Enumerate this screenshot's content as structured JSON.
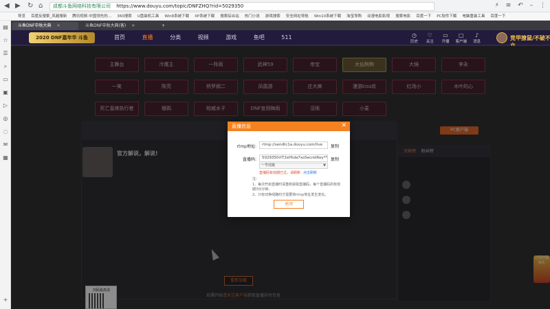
{
  "browser": {
    "address_cert": "成都斗鱼网络科技有限公司",
    "address_url": "https://www.douyu.com/topic/DNFZHQ?rid=5029350",
    "bookmarks": [
      "导览",
      "百度反搜索_风越搜新",
      "腾讯视频-中国领先的…",
      "360搜索",
      "U盘装机工具",
      "Win8系统下载",
      "XP系统下载",
      "搜索综合站",
      "热门小说",
      "游戏搜索",
      "安全网址导航",
      "Win10系统下载",
      "淘宝导购",
      "动漫电影影视",
      "搜索电影",
      "百度一下",
      "PC软件下载",
      "电脑重装工具",
      "百度一下"
    ]
  },
  "tabs": [
    {
      "label": "斗鱼DNF中秋大典",
      "active": true
    },
    {
      "label": "斗鱼DNF中秋大典(客)",
      "active": false
    }
  ],
  "site": {
    "logo_text": "2020 DNF嘉年华 斗鱼",
    "nav": [
      "首页",
      "直播",
      "分类",
      "视频",
      "游戏",
      "鱼吧",
      "511"
    ],
    "nav_active_index": 1,
    "header_icons": [
      {
        "icon": "clock-icon",
        "label": "历史"
      },
      {
        "icon": "star-icon",
        "label": "关注"
      },
      {
        "icon": "video-icon",
        "label": "开播"
      },
      {
        "icon": "app-icon",
        "label": "客户端"
      },
      {
        "icon": "bell-icon",
        "label": "消息"
      }
    ],
    "username": "竞甲撩鼠/不破不立"
  },
  "streamer_grid": [
    "主舞台",
    "冷鹰主",
    "一阵雨",
    "武神59",
    "帝宝",
    "大仙狗狗",
    "大镜",
    "李永",
    "一笑",
    "陈亮",
    "桥罗纲二",
    "凤凰游",
    "庄大麻",
    "漫游kiss欢",
    "红场小",
    "木叶的心",
    "死亡直席执行者",
    "银鸦",
    "柏威水子",
    "DNF宣用梅雨",
    "涩雨",
    "小麦"
  ],
  "streamer_highlight_index": 5,
  "room": {
    "title": "官方解说，解说!",
    "pc_button": "PC客户端",
    "rank_header": "贡献榜",
    "rank_tab": "粉丝榜",
    "play_button": "重新加载",
    "help_text": "如遇开始",
    "help_link": "请关注客户端",
    "help_tail": "获取直播实时信息",
    "qr_caption": "扫码看高清"
  },
  "modal": {
    "title": "直播信息",
    "rtmp_label": "rtmp地址:",
    "rtmp_value": "rtmp://sendtc1a.douyu.com/live",
    "key_label": "直播码:",
    "key_value": "5029350rtT2eHtda7xoSecretKey****************",
    "copy_label": "复制",
    "select_value": "一号线路",
    "warning": "直播码有效期已过，请刷新",
    "refresh_link": "点击刷新",
    "notes_title": "注：",
    "notes": [
      "1、每次开启直播时请重新获取直播码，每个直播码的有效期为5分钟。",
      "2、只有切换线路时才需要将rtmp地址发生变化。"
    ],
    "close_button": "关闭"
  },
  "promo_text": "订阅开播有礼"
}
